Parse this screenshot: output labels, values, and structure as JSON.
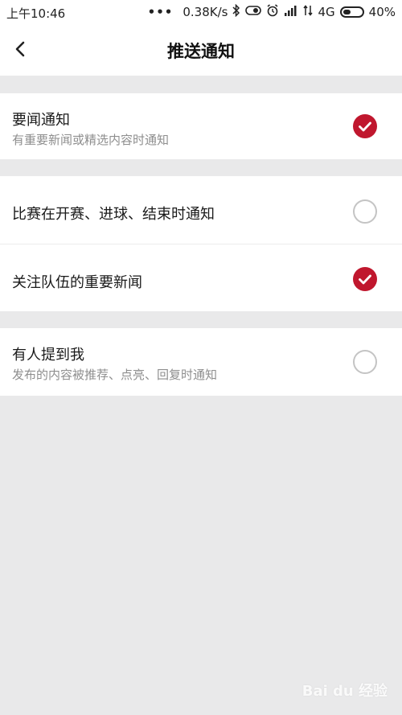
{
  "status_bar": {
    "time": "上午10:46",
    "network_speed": "0.38K/s",
    "network_type": "4G",
    "battery": "40%",
    "battery_level": 0.4
  },
  "header": {
    "title": "推送通知",
    "back_icon": "chevron-left-icon"
  },
  "settings": [
    {
      "title": "要闻通知",
      "subtitle": "有重要新闻或精选内容时通知",
      "checked": true
    },
    {
      "title": "比赛在开赛、进球、结束时通知",
      "subtitle": "",
      "checked": false
    },
    {
      "title": "关注队伍的重要新闻",
      "subtitle": "",
      "checked": true
    },
    {
      "title": "有人提到我",
      "subtitle": "发布的内容被推荐、点亮、回复时通知",
      "checked": false
    }
  ],
  "colors": {
    "accent": "#c0172e",
    "background": "#e9e9ea"
  },
  "watermark": "Bai du 经验"
}
